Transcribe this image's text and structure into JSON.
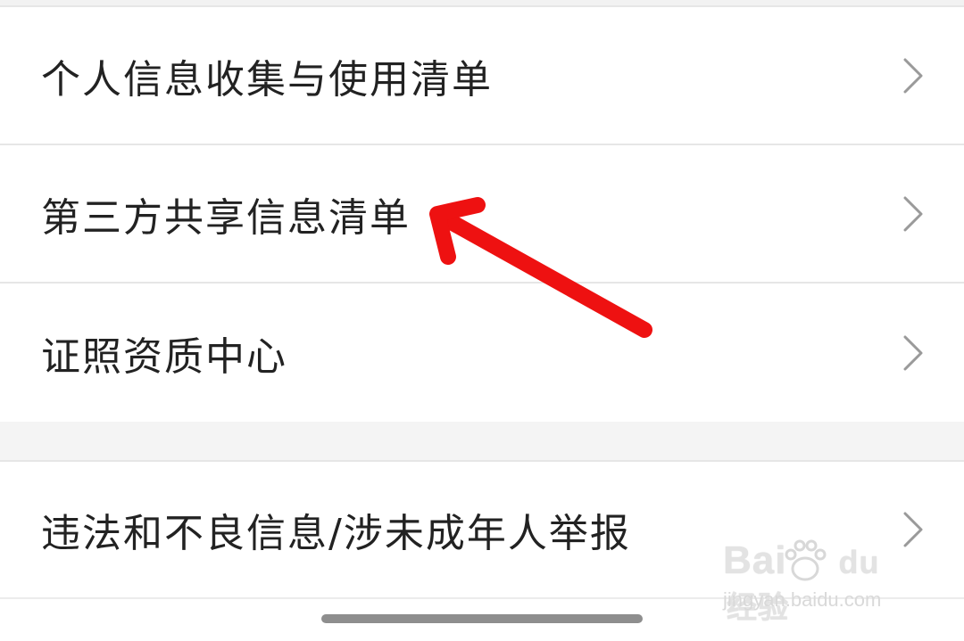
{
  "list_items": [
    {
      "label": "个人信息收集与使用清单"
    },
    {
      "label": "第三方共享信息清单"
    },
    {
      "label": "证照资质中心"
    }
  ],
  "report_item": {
    "label": "违法和不良信息/涉未成年人举报"
  },
  "watermark": {
    "logo_text": "Bai",
    "logo_text_2": "du",
    "logo_cn": "经验",
    "site": "jingyan.baidu.com"
  },
  "colors": {
    "text": "#222222",
    "divider": "#e6e6e6",
    "chevron": "#9a9a9a",
    "arrow": "#ee1111",
    "section_bg": "#f4f4f4"
  },
  "icons": {
    "row_chevron": "chevron-right-icon",
    "annotation": "red-arrow-annotation"
  }
}
